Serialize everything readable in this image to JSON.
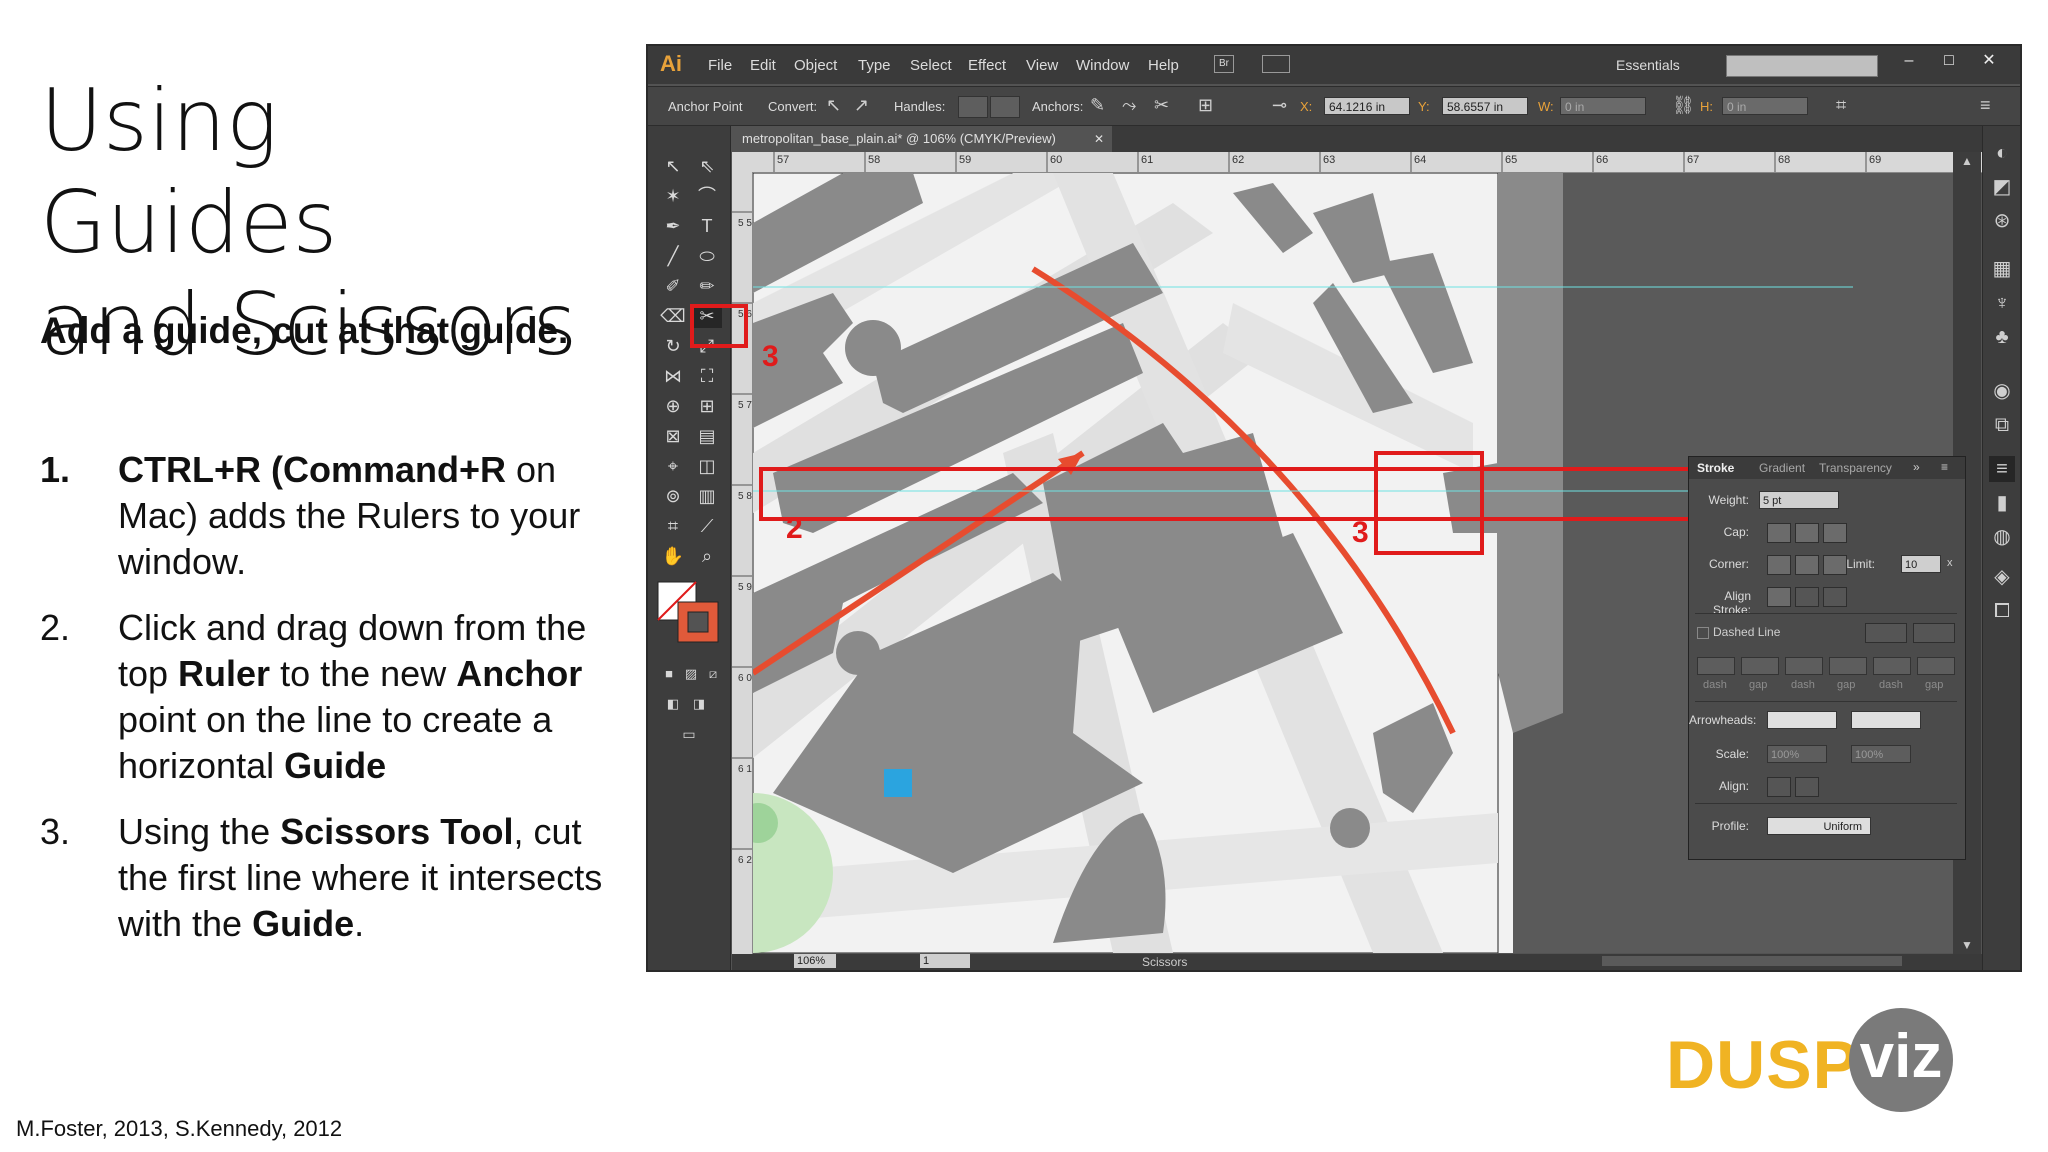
{
  "slide": {
    "title_line1": "Using Guides",
    "title_line2": "and Scissors",
    "subtitle": "Add a guide, cut at that guide.",
    "steps": [
      {
        "num": "1.",
        "parts": [
          {
            "t": "CTRL+R (Command+R",
            "b": true
          },
          {
            "t": " on Mac) adds the Rulers to your window.",
            "b": false
          }
        ]
      },
      {
        "num": "2.",
        "parts": [
          {
            "t": "Click and drag down from the top ",
            "b": false
          },
          {
            "t": "Ruler",
            "b": true
          },
          {
            "t": " to the new ",
            "b": false
          },
          {
            "t": "Anchor",
            "b": true
          },
          {
            "t": " point on the line to create a horizontal ",
            "b": false
          },
          {
            "t": "Guide",
            "b": true
          }
        ]
      },
      {
        "num": "3.",
        "parts": [
          {
            "t": "Using the ",
            "b": false
          },
          {
            "t": "Scissors Tool",
            "b": true
          },
          {
            "t": ", cut the first line where it intersects with the ",
            "b": false
          },
          {
            "t": "Guide",
            "b": true
          },
          {
            "t": ".",
            "b": false
          }
        ]
      }
    ],
    "credit": "M.Foster, 2013, S.Kennedy, 2012",
    "logo_left": "DUSP",
    "logo_right": "viz",
    "logo_color": "#f0b323"
  },
  "illustrator": {
    "app_logo": "Ai",
    "menu": [
      "File",
      "Edit",
      "Object",
      "Type",
      "Select",
      "Effect",
      "View",
      "Window",
      "Help"
    ],
    "bridge_label": "Br",
    "workspace": "Essentials",
    "control_bar": {
      "anchor_point": "Anchor Point",
      "convert": "Convert:",
      "handles": "Handles:",
      "anchors": "Anchors:",
      "x_label": "X:",
      "x_value": "64.1216 in",
      "y_label": "Y:",
      "y_value": "58.6557 in",
      "w_label": "W:",
      "w_value": "0 in",
      "h_label": "H:",
      "h_value": "0 in"
    },
    "document_tab": "metropolitan_base_plain.ai* @ 106% (CMYK/Preview)",
    "ruler_top_ticks": [
      "57",
      "58",
      "59",
      "60",
      "61",
      "62",
      "63",
      "64",
      "65",
      "66",
      "67",
      "68",
      "69"
    ],
    "ruler_left_ticks": [
      "5 5",
      "5 6",
      "5 7",
      "5 8",
      "5 9",
      "6 0",
      "6 1",
      "6 2"
    ],
    "status": {
      "zoom": "106%",
      "page": "1",
      "current_tool": "Scissors"
    },
    "stroke_panel": {
      "tabs": [
        "Stroke",
        "Gradient",
        "Transparency"
      ],
      "weight_label": "Weight:",
      "weight_value": "5 pt",
      "cap_label": "Cap:",
      "corner_label": "Corner:",
      "limit_label": "Limit:",
      "limit_value": "10",
      "limit_unit": "x",
      "align_stroke_label": "Align Stroke:",
      "dashed_line_label": "Dashed Line",
      "dash_labels": [
        "dash",
        "gap",
        "dash",
        "gap",
        "dash",
        "gap"
      ],
      "arrowheads_label": "Arrowheads:",
      "scale_label": "Scale:",
      "scale_value_1": "100%",
      "scale_value_2": "100%",
      "align_label": "Align:",
      "profile_label": "Profile:",
      "profile_value": "Uniform"
    },
    "annotations": {
      "label_tool": "3",
      "label_guide": "2",
      "label_cut": "3",
      "color": "#e01b1b"
    }
  }
}
